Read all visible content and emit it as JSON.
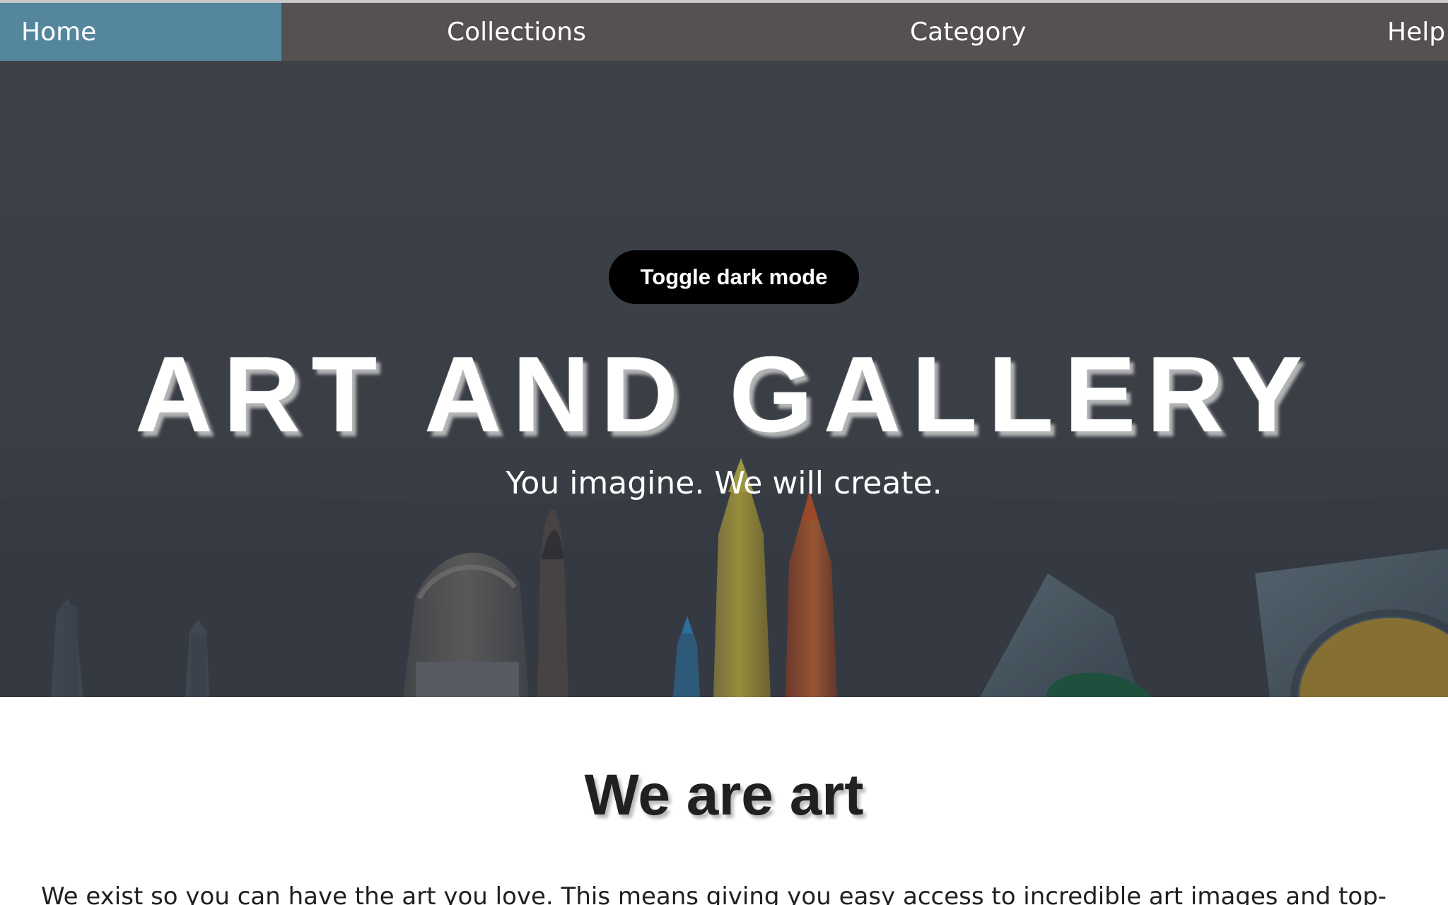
{
  "nav": {
    "items": [
      {
        "label": "Home",
        "active": true
      },
      {
        "label": "Collections"
      },
      {
        "label": "Category"
      },
      {
        "label": "Help"
      }
    ],
    "colors": {
      "bar": "#545150",
      "active": "#54879e",
      "text": "#ffffff"
    }
  },
  "hero": {
    "toggle_button_label": "Toggle dark mode",
    "title": "ART AND GALLERY",
    "subtitle": "You imagine. We will create.",
    "background_description_colors": {
      "overlay": "#3f434a",
      "accent_yellow": "#d8a622",
      "accent_orange": "#d45d27",
      "accent_blue": "#338fd1",
      "accent_green": "#16663d"
    }
  },
  "about": {
    "heading": "We are art",
    "paragraph": "We exist so you can have the art you love. This means giving you easy access to incredible art images and top-"
  },
  "icons": {
    "toggle": "toggle-dark-mode-icon"
  }
}
